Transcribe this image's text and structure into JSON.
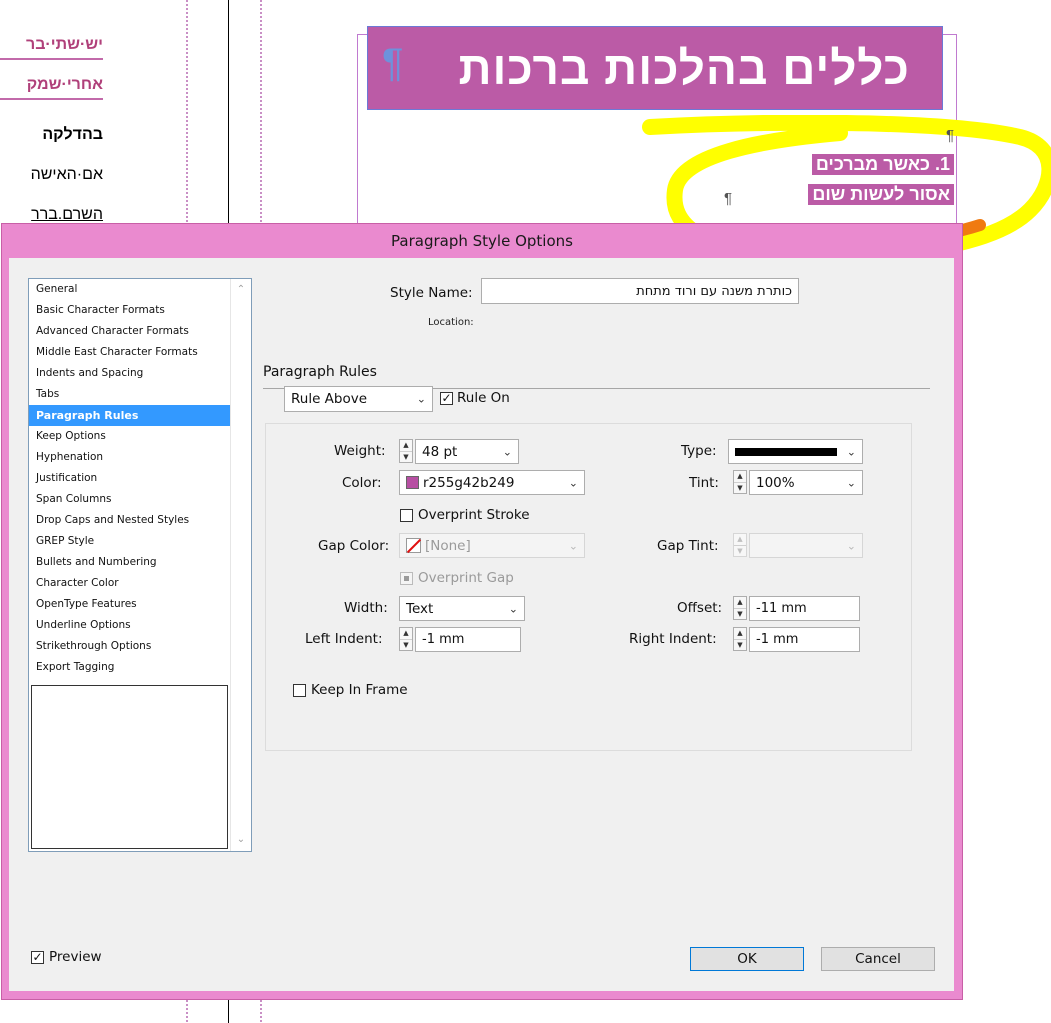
{
  "document": {
    "left_fragments": [
      "יש·שתי·בר",
      "אחרי·שמק",
      "בהדלקה",
      "אם·האישה",
      "השרם.ברר"
    ],
    "heading": "כללים בהלכות ברכות",
    "pilcrow": "¶",
    "list_line_1": "1.  כאשר מברכים",
    "list_line_2": "אסור לעשות שום"
  },
  "dialog": {
    "title": "Paragraph Style Options",
    "categories": [
      "General",
      "Basic Character Formats",
      "Advanced Character Formats",
      "Middle East Character Formats",
      "Indents and Spacing",
      "Tabs",
      "Paragraph Rules",
      "Keep Options",
      "Hyphenation",
      "Justification",
      "Span Columns",
      "Drop Caps and Nested Styles",
      "GREP Style",
      "Bullets and Numbering",
      "Character Color",
      "OpenType Features",
      "Underline Options",
      "Strikethrough Options",
      "Export Tagging"
    ],
    "selected_category": "Paragraph Rules",
    "style_name_label": "Style Name:",
    "style_name_value": "כותרת משנה עם ורוד מתחת",
    "location_label": "Location:",
    "section_title": "Paragraph Rules",
    "rule_select": "Rule Above",
    "rule_on_label": "Rule On",
    "rule_on_checked": true,
    "weight_label": "Weight:",
    "weight_value": "48 pt",
    "type_label": "Type:",
    "color_label": "Color:",
    "color_value": "r255g42b249",
    "color_swatch": "#b74fa3",
    "tint_label": "Tint:",
    "tint_value": "100%",
    "overprint_stroke_label": "Overprint Stroke",
    "gap_color_label": "Gap Color:",
    "gap_color_value": "[None]",
    "gap_tint_label": "Gap Tint:",
    "overprint_gap_label": "Overprint Gap",
    "width_label": "Width:",
    "width_value": "Text",
    "offset_label": "Offset:",
    "offset_value": "-11 mm",
    "left_indent_label": "Left Indent:",
    "left_indent_value": "-1 mm",
    "right_indent_label": "Right Indent:",
    "right_indent_value": "-1 mm",
    "keep_in_frame_label": "Keep In Frame",
    "preview_label": "Preview",
    "preview_checked": true,
    "ok_label": "OK",
    "cancel_label": "Cancel"
  },
  "colors": {
    "heading_bg": "#bb5ba6",
    "dialog_frame": "#ea8acf",
    "selection": "#3399ff",
    "highlighter": "#ffff00",
    "highlighter_orange": "#f07a10"
  }
}
